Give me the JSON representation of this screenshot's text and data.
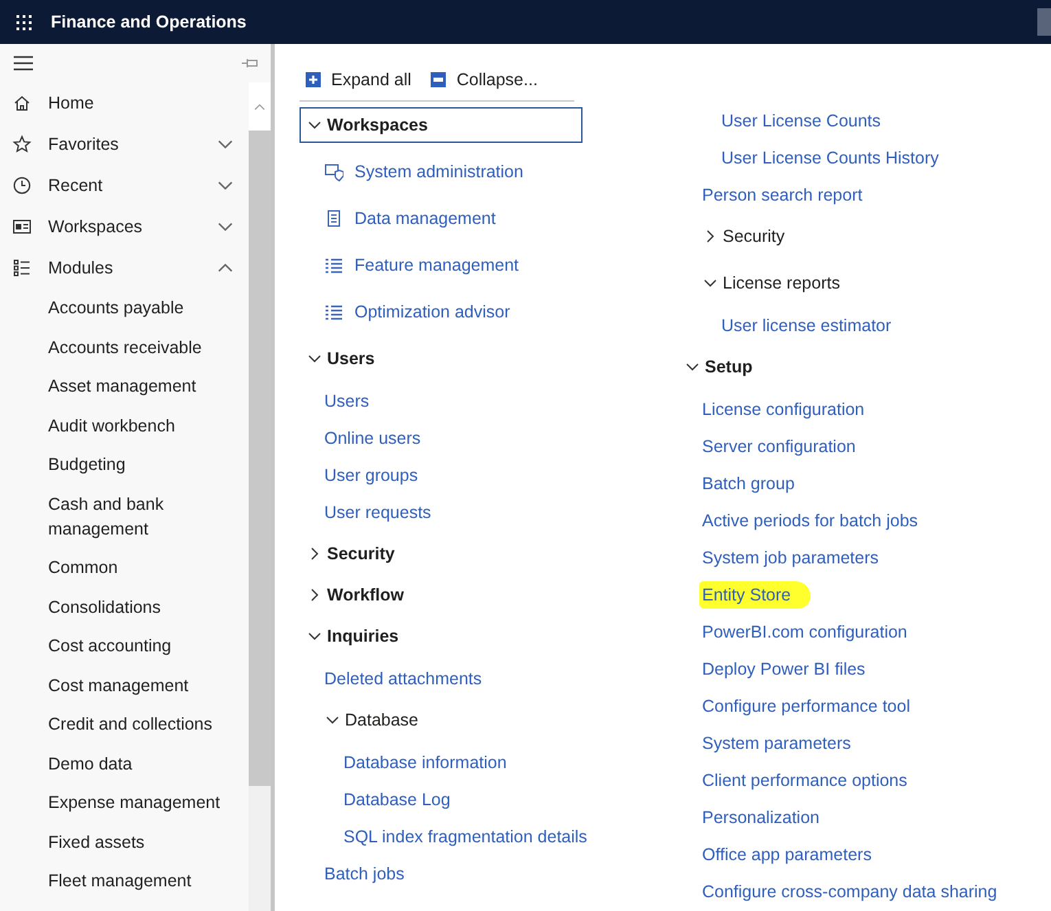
{
  "app_bar": {
    "title": "Finance and Operations"
  },
  "sidebar": {
    "nav": [
      {
        "label": "Home"
      },
      {
        "label": "Favorites",
        "expanded": false
      },
      {
        "label": "Recent",
        "expanded": false
      },
      {
        "label": "Workspaces",
        "expanded": false
      },
      {
        "label": "Modules",
        "expanded": true,
        "children": [
          {
            "label": "Accounts payable"
          },
          {
            "label": "Accounts receivable"
          },
          {
            "label": "Asset management"
          },
          {
            "label": "Audit workbench"
          },
          {
            "label": "Budgeting"
          },
          {
            "label": "Cash and bank management"
          },
          {
            "label": "Common"
          },
          {
            "label": "Consolidations"
          },
          {
            "label": "Cost accounting"
          },
          {
            "label": "Cost management"
          },
          {
            "label": "Credit and collections"
          },
          {
            "label": "Demo data"
          },
          {
            "label": "Expense management"
          },
          {
            "label": "Fixed assets"
          },
          {
            "label": "Fleet management"
          }
        ]
      }
    ]
  },
  "toolbar": [
    {
      "kind": "expand",
      "label": "Expand all"
    },
    {
      "kind": "collapse",
      "label": "Collapse..."
    }
  ],
  "columns": [
    {
      "items": [
        {
          "kind": "group",
          "label": "Workspaces",
          "expanded": true,
          "focused": true,
          "children": [
            {
              "kind": "workspace_link",
              "label": "System administration"
            },
            {
              "kind": "workspace_link",
              "label": "Data management"
            },
            {
              "kind": "workspace_link",
              "label": "Feature management"
            },
            {
              "kind": "workspace_link",
              "label": "Optimization advisor"
            }
          ]
        },
        {
          "kind": "group",
          "label": "Users",
          "expanded": true,
          "focused": false,
          "children": [
            {
              "kind": "link",
              "label": "Users"
            },
            {
              "kind": "link",
              "label": "Online users"
            },
            {
              "kind": "link",
              "label": "User groups"
            },
            {
              "kind": "link",
              "label": "User requests"
            }
          ]
        },
        {
          "kind": "group",
          "label": "Security",
          "expanded": false,
          "focused": false
        },
        {
          "kind": "group",
          "label": "Workflow",
          "expanded": false,
          "focused": false
        },
        {
          "kind": "group",
          "label": "Inquiries",
          "expanded": true,
          "focused": false,
          "children": [
            {
              "kind": "link",
              "label": "Deleted attachments"
            },
            {
              "kind": "subgroup",
              "label": "Database",
              "expanded": true,
              "children": [
                {
                  "kind": "link",
                  "label": "Database information"
                },
                {
                  "kind": "link",
                  "label": "Database Log"
                },
                {
                  "kind": "link",
                  "label": "SQL index fragmentation details"
                }
              ]
            },
            {
              "kind": "link",
              "label": "Batch jobs"
            }
          ]
        }
      ]
    },
    {
      "items": [
        {
          "kind": "continued",
          "children": [
            {
              "kind": "continued",
              "children": [
                {
                  "kind": "link",
                  "label": "User License Counts"
                },
                {
                  "kind": "link",
                  "label": "User License Counts History"
                }
              ]
            },
            {
              "kind": "link",
              "label": "Person search report"
            },
            {
              "kind": "subgroup",
              "label": "Security",
              "expanded": false
            },
            {
              "kind": "subgroup",
              "label": "License reports",
              "expanded": true,
              "children": [
                {
                  "kind": "link",
                  "label": "User license estimator"
                }
              ]
            }
          ]
        },
        {
          "kind": "group",
          "label": "Setup",
          "expanded": true,
          "focused": false,
          "children": [
            {
              "kind": "link",
              "label": "License configuration",
              "highlighted": false
            },
            {
              "kind": "link",
              "label": "Server configuration",
              "highlighted": false
            },
            {
              "kind": "link",
              "label": "Batch group",
              "highlighted": false
            },
            {
              "kind": "link",
              "label": "Active periods for batch jobs",
              "highlighted": false
            },
            {
              "kind": "link",
              "label": "System job parameters",
              "highlighted": false
            },
            {
              "kind": "link",
              "label": "Entity Store",
              "highlighted": true
            },
            {
              "kind": "link",
              "label": "PowerBI.com configuration",
              "highlighted": false
            },
            {
              "kind": "link",
              "label": "Deploy Power BI files",
              "highlighted": false
            },
            {
              "kind": "link",
              "label": "Configure performance tool",
              "highlighted": false
            },
            {
              "kind": "link",
              "label": "System parameters",
              "highlighted": false
            },
            {
              "kind": "link",
              "label": "Client performance options",
              "highlighted": false
            },
            {
              "kind": "link",
              "label": "Personalization",
              "highlighted": false
            },
            {
              "kind": "link",
              "label": "Office app parameters",
              "highlighted": false
            },
            {
              "kind": "link",
              "label": "Configure cross-company data sharing",
              "highlighted": false
            }
          ]
        }
      ]
    }
  ]
}
